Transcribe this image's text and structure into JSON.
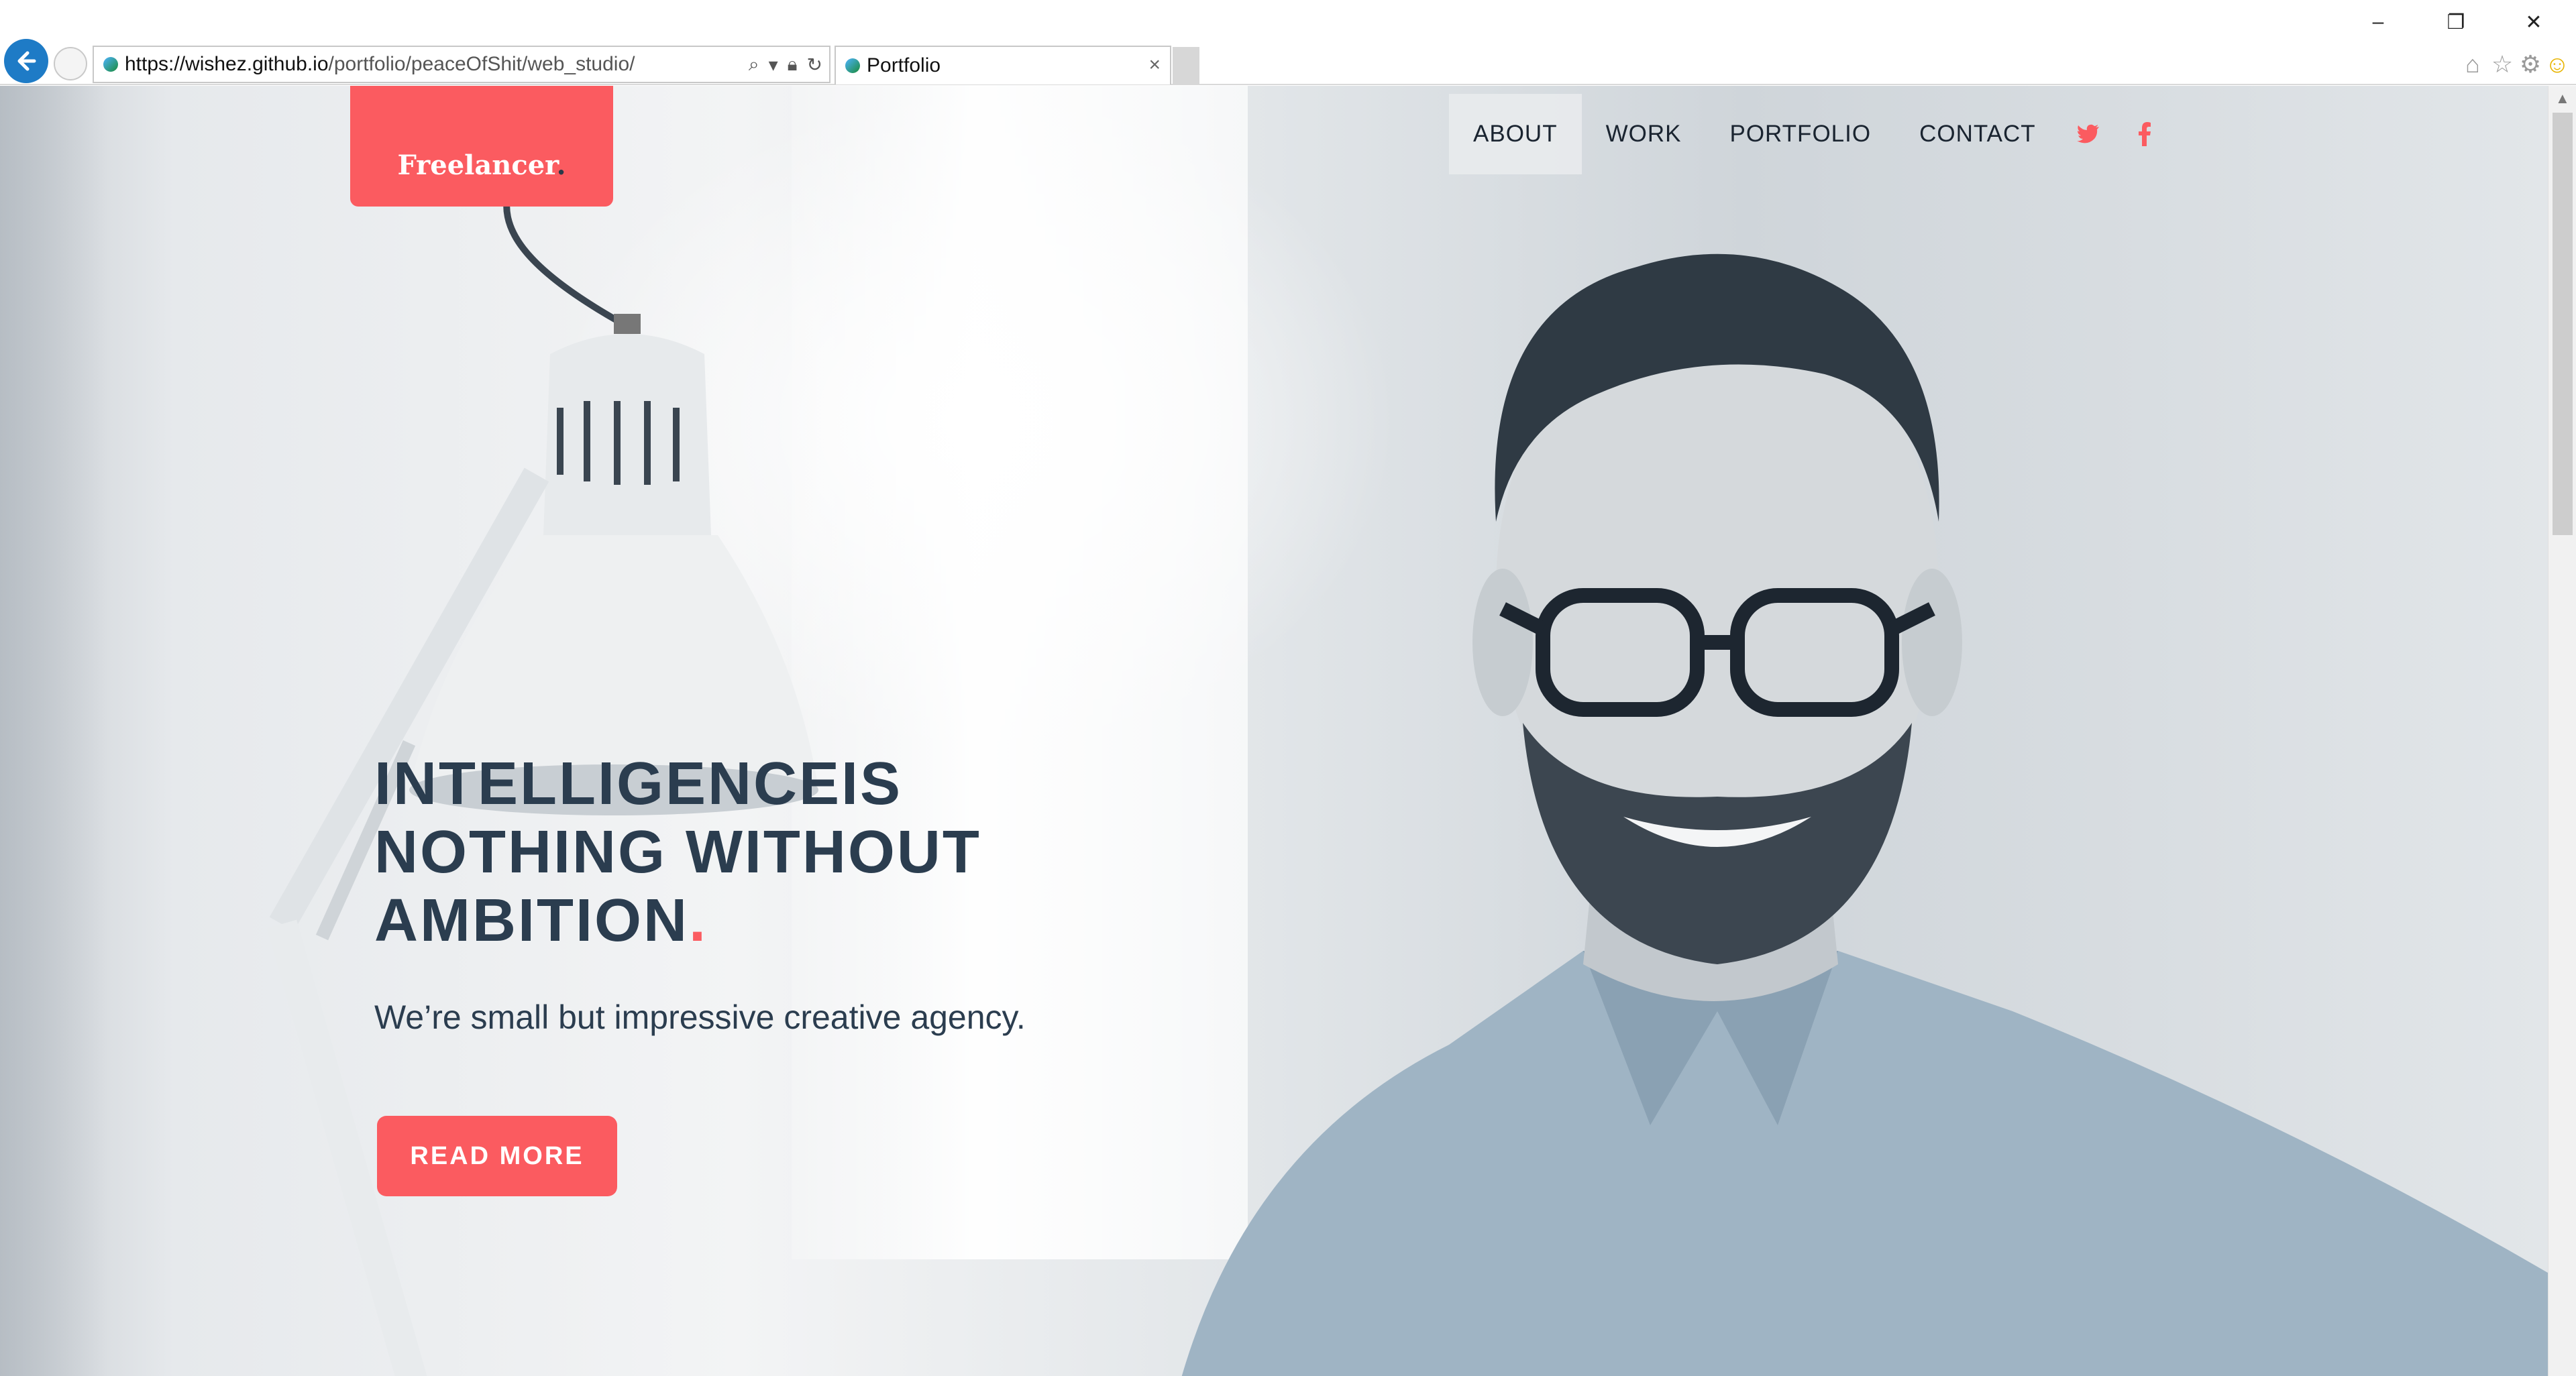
{
  "browser": {
    "url_host": "https://wishez.github.io",
    "url_path": "/portfolio/peaceOfShit/web_studio/",
    "tab_title": "Portfolio",
    "tab_close": "×",
    "window_minimize": "–",
    "window_restore": "❐",
    "window_close": "✕"
  },
  "site": {
    "logo_text": "Freelancer",
    "logo_dot": ".",
    "nav": {
      "about": "ABOUT",
      "work": "WORK",
      "portfolio": "PORTFOLIO",
      "contact": "CONTACT"
    },
    "hero": {
      "line1": "INTELLIGENCEIS",
      "line2": "NOTHING WITHOUT",
      "line3": "AMBITION",
      "line3_dot": ".",
      "subtitle": "We’re small but impressive creative agency.",
      "button": "READ MORE"
    },
    "colors": {
      "accent": "#fb5b60",
      "text_dark": "#2b3d4f",
      "browser_back": "#1e7bc6"
    },
    "icons": [
      "twitter-icon",
      "facebook-icon",
      "search-icon",
      "lock-icon",
      "refresh-icon",
      "home-icon",
      "star-icon",
      "gear-icon",
      "smiley-icon"
    ]
  }
}
